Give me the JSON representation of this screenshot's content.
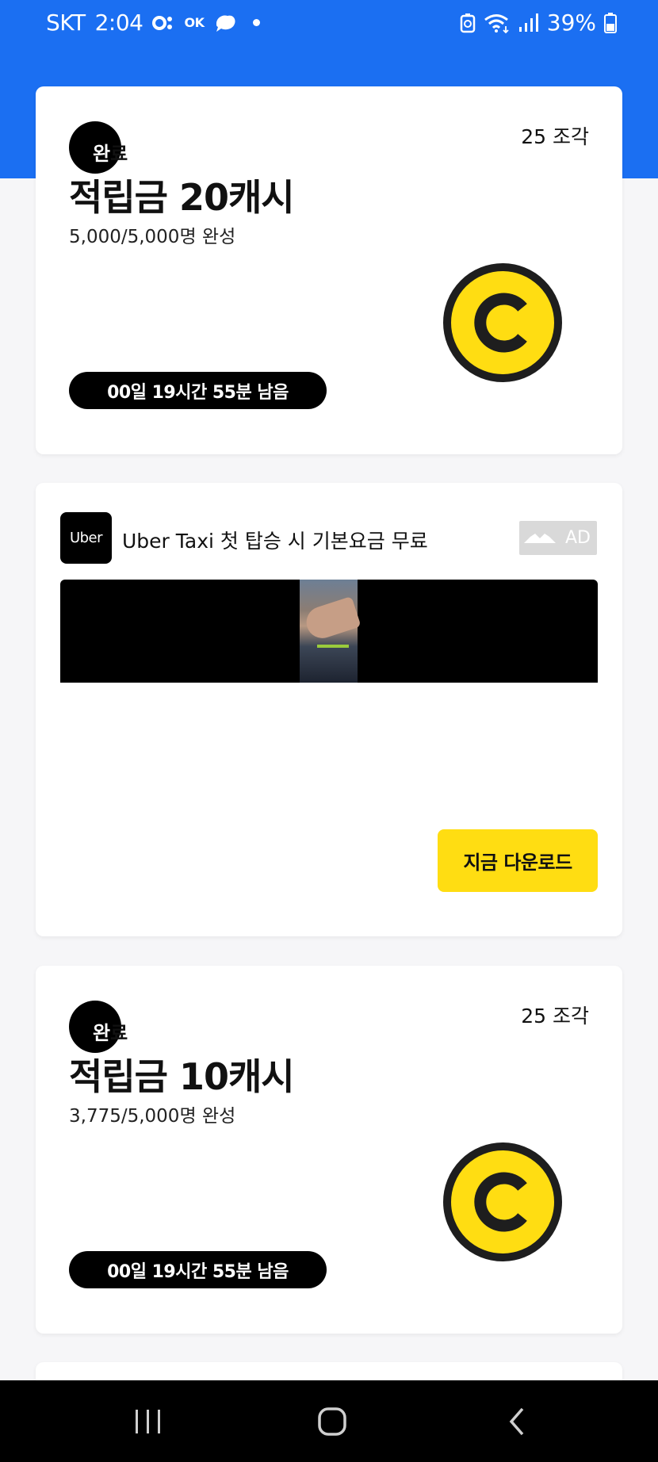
{
  "status_bar": {
    "carrier": "SKT",
    "time": "2:04",
    "ok_label": "OK",
    "battery": "39%",
    "icons": [
      "app-o-icon",
      "ok-cashbag-icon",
      "leaf-icon",
      "notification-dot-icon",
      "recycle-icon",
      "wifi-icon",
      "signal-icon",
      "battery-icon"
    ]
  },
  "colors": {
    "header_blue": "#1b6ff2",
    "coin_yellow": "#ffdd12",
    "cta_yellow": "#ffdd12"
  },
  "reward_cards": [
    {
      "pieces": "25 조각",
      "done_label_first": "완",
      "done_label_rest": "료",
      "title": "적립금 20캐시",
      "progress": "5,000/5,000명 완성",
      "timer": "00일 19시간 55분 남음"
    },
    {
      "pieces": "25 조각",
      "done_label_first": "완",
      "done_label_rest": "료",
      "title": "적립금 10캐시",
      "progress": "3,775/5,000명 완성",
      "timer": "00일 19시간 55분 남음"
    }
  ],
  "ad_card": {
    "logo_text": "Uber",
    "title": "Uber Taxi 첫 탑승 시 기본요금 무료",
    "badge": "AD",
    "cta": "지금 다운로드"
  },
  "nav_bar": {
    "recent_icon": "recent-apps-icon",
    "home_icon": "home-icon",
    "back_icon": "back-icon"
  }
}
